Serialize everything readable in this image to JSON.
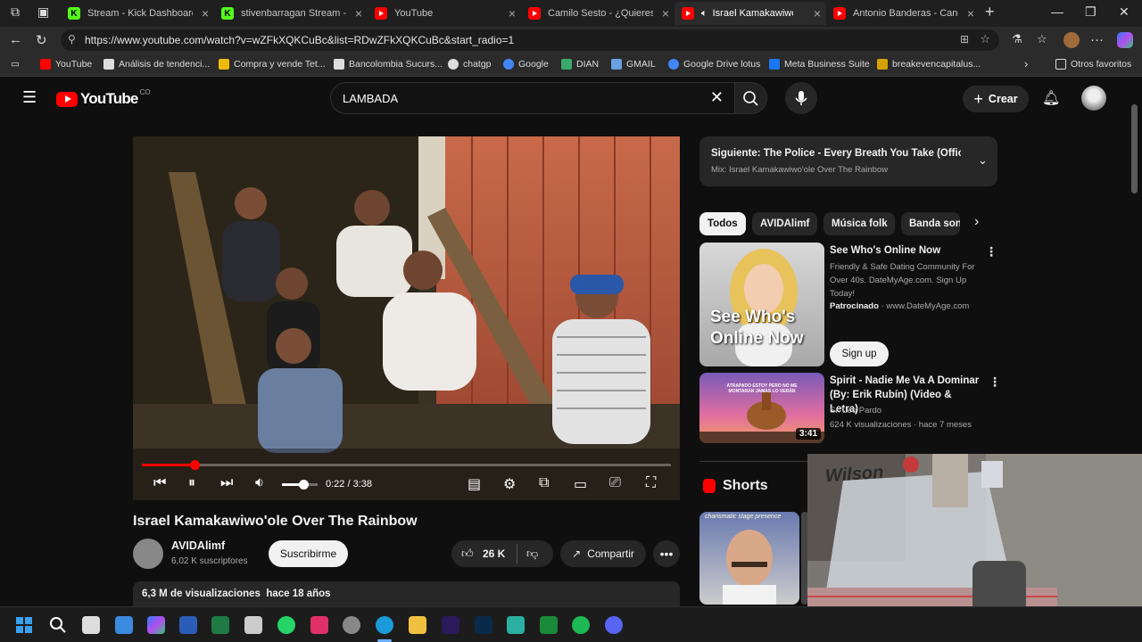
{
  "browser": {
    "tabs": [
      {
        "label": "Stream - Kick Dashboard",
        "favicon": "kick"
      },
      {
        "label": "stivenbarragan Stream - W",
        "favicon": "kick"
      },
      {
        "label": "YouTube",
        "favicon": "youtube"
      },
      {
        "label": "Camilo Sesto - ¿Quieres se",
        "favicon": "youtube"
      },
      {
        "label": "Israel Kamakawiwo'ole",
        "favicon": "youtube",
        "active": true
      },
      {
        "label": "Antonio Banderas - Cancio",
        "favicon": "youtube"
      }
    ],
    "url": "https://www.youtube.com/watch?v=wZFkXQKCuBc&list=RDwZFkXQKCuBc&start_radio=1",
    "bookmarks": [
      "YouTube",
      "Análisis de tendenci...",
      "Compra y vende Tet...",
      "Bancolombia Sucurs...",
      "chatgp",
      "Google",
      "DIAN",
      "GMAIL",
      "Google Drive lotus",
      "Meta Business Suite",
      "breakevencapitalus..."
    ],
    "other_bookmarks": "Otros favoritos"
  },
  "youtube": {
    "logo_word": "YouTube",
    "country": "CO",
    "search_value": "LAMBADA",
    "create_label": "Crear",
    "player": {
      "current_time": "0:22",
      "duration": "3:38",
      "progress_fraction": 0.1,
      "volume_fraction": 0.6
    },
    "video": {
      "title": "Israel Kamakawiwo'ole Over The Rainbow",
      "channel": "AVIDAlimf",
      "subscribers": "6,02 K suscriptores",
      "subscribe_label": "Suscribirme",
      "likes": "26 K",
      "share_label": "Compartir",
      "views": "6,3 M de visualizaciones",
      "age": "hace 18 años"
    },
    "next": {
      "title": "Siguiente: The Police - Every Breath You Take (Offici...",
      "mix": "Mix: Israel Kamakawiwo'ole Over The Rainbow"
    },
    "chips": [
      "Todos",
      "AVIDAlimf",
      "Música folk",
      "Banda sonora"
    ],
    "ad": {
      "title": "See Who's Online Now",
      "thumb_text": "See Who's Online Now",
      "desc": "Friendly & Safe Dating Community For Over 40s. DateMyAge.com. Sign Up Today!",
      "sponsored": "Patrocinado",
      "domain": "www.DateMyAge.com",
      "cta": "Sign up"
    },
    "rec1": {
      "title": "Spirit - Nadie Me Va A Dominar (By: Erik Rubín) (Video & Letra)",
      "channel": "Sr. Leo Pardo",
      "meta": "624 K visualizaciones · hace 7 meses",
      "duration": "3:41",
      "thumb_text": "ATRAPADO ESTOY PERO NO ME MONTARAN JAMAS LO VERÁN"
    },
    "shorts_label": "Shorts",
    "short1_text": "charismatic stage presence"
  },
  "webcam": {
    "wall_text": "Wilson"
  },
  "colors": {
    "accent": "#ff0000",
    "bg": "#0f0f0f",
    "chip": "#272727"
  }
}
